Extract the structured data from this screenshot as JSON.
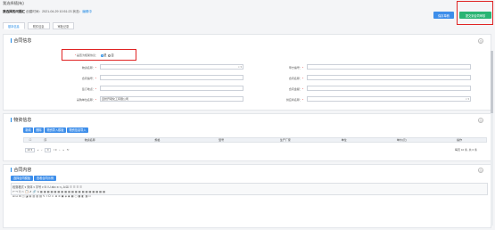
{
  "window_title": "我选择随(有)",
  "subheader": {
    "name": "我选择的问题汇",
    "created_label": "创建时间：",
    "created_value": "2021-04-29 10:51:23",
    "status_label": "状态：",
    "status_value": "编辑中"
  },
  "buttons": {
    "save": "保存草稿",
    "submit": "提交到合同审核"
  },
  "tabs": [
    "基本信息",
    "附件信息",
    "审批记录"
  ],
  "contract_info": {
    "title": "合同信息",
    "framework_label": "是否为框架协议：",
    "framework_yes": "是",
    "framework_no": "否",
    "fields_left": [
      {
        "label": "物资名称：",
        "value": ""
      },
      {
        "label": "合同编号：",
        "value": ""
      },
      {
        "label": "签订地点：",
        "value": ""
      },
      {
        "label": "采购单位名称：",
        "value": "迈智开项化工有限公司"
      }
    ],
    "fields_right": [
      {
        "label": "甲方编号：",
        "value": ""
      },
      {
        "label": "合同名称：",
        "value": ""
      },
      {
        "label": "合同金额：",
        "value": ""
      },
      {
        "label": "供应商名称：",
        "value": ""
      }
    ]
  },
  "material_info": {
    "title": "物资信息",
    "buttons": [
      "新增",
      "删除",
      "物资导入模板",
      "物资信息导入"
    ],
    "columns": [
      "序",
      "物资名称",
      "规格",
      "型号",
      "生产厂家",
      "单位",
      "单价(元)",
      "操作"
    ],
    "pager": {
      "page_size": "10",
      "current": "0",
      "total_pages": "/ 0",
      "summary": "每页 10 条, 共 0 条"
    }
  },
  "contract_content": {
    "title": "合同内容",
    "buttons": [
      "选择合同模板",
      "查看合同示例"
    ],
    "toolbar_row1": "段落格式 ▾  宋体 ▾  字号 ▾  B  I  U  abc  x²  x₂  A  ⌧  ☰  ☰  ☰  ☰",
    "toolbar_row2": "↶ ↷ ⎘ ✂ 📋 ✗ 🔗 ⇲ ▦ ▦ ▦ ▦ ▦ ▦ ▦ ▦ ▦ ▦ ▦ ▦ ▦ ▦ ▦ ▦ ▦ ▦ ▦",
    "toolbar_row3": "⊞ ⊟ ⊠ ◫ ◪ ▤ ▥ ▨ ▧ ✎ ⌗ Ω ☺ ⊕ ⊘ ▣ ◈ ◉ ▦ ▢ ▩ ◧ ◨ ⊡"
  }
}
